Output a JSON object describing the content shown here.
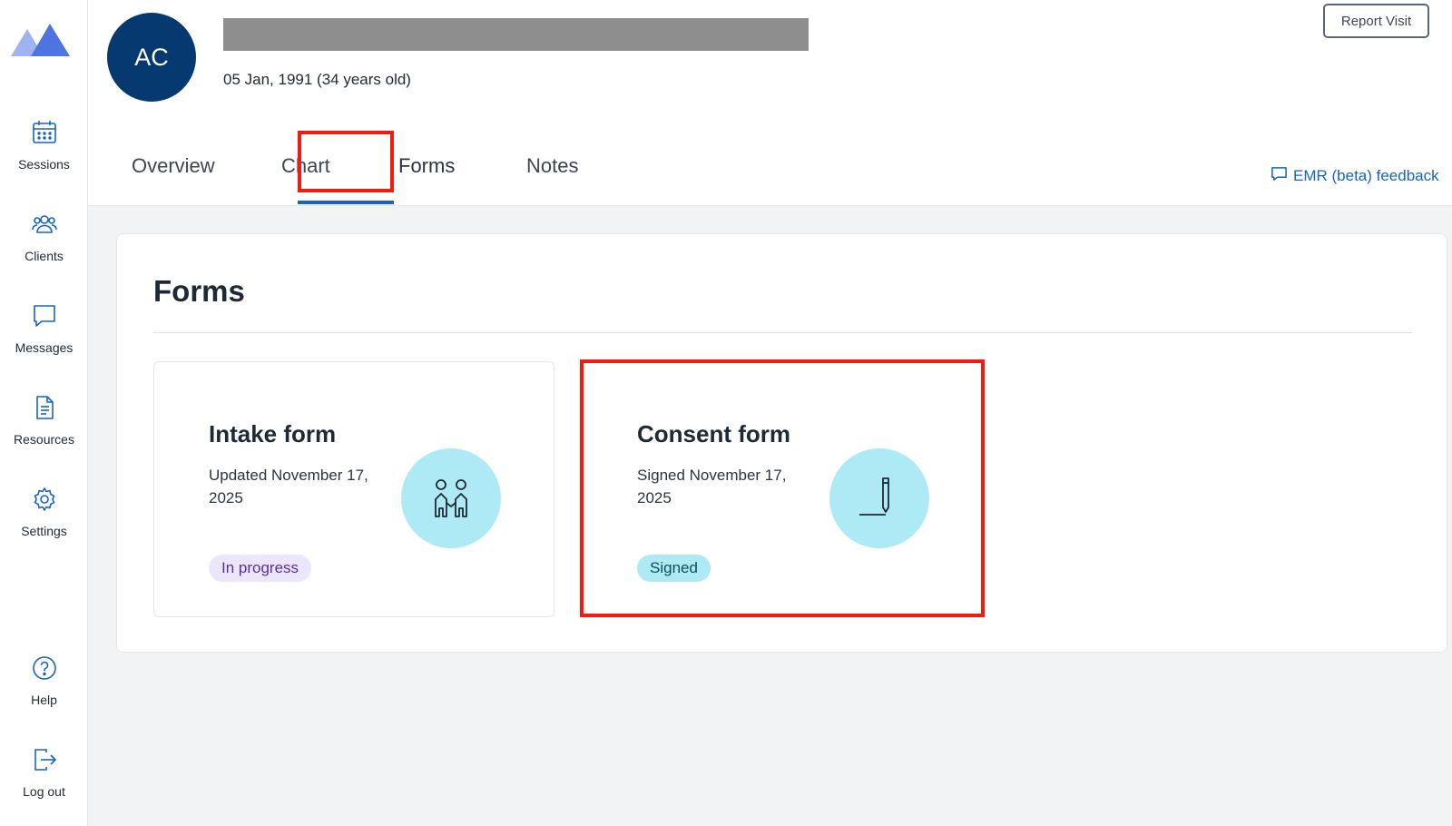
{
  "sidebar": {
    "items": [
      {
        "label": "Sessions",
        "icon": "calendar-icon"
      },
      {
        "label": "Clients",
        "icon": "users-icon"
      },
      {
        "label": "Messages",
        "icon": "chat-icon"
      },
      {
        "label": "Resources",
        "icon": "document-icon"
      },
      {
        "label": "Settings",
        "icon": "gear-icon"
      },
      {
        "label": "Help",
        "icon": "help-icon"
      },
      {
        "label": "Log out",
        "icon": "logout-icon"
      }
    ]
  },
  "header": {
    "avatar_initials": "AC",
    "dob": "05 Jan, 1991 (34 years old)",
    "report_visit": "Report Visit",
    "feedback": "EMR (beta) feedback"
  },
  "tabs": [
    {
      "label": "Overview"
    },
    {
      "label": "Chart"
    },
    {
      "label": "Forms",
      "active": true
    },
    {
      "label": "Notes"
    }
  ],
  "main": {
    "title": "Forms",
    "cards": [
      {
        "title": "Intake form",
        "subtitle": "Updated November 17, 2025",
        "status": "In progress",
        "icon": "people-icon"
      },
      {
        "title": "Consent form",
        "subtitle": "Signed November 17, 2025",
        "status": "Signed",
        "icon": "pen-signature-icon"
      }
    ]
  },
  "colors": {
    "accent": "#1565c0",
    "avatar": "#063970",
    "highlight": "#f31b0f",
    "icon_circle": "#aeeaf5"
  }
}
